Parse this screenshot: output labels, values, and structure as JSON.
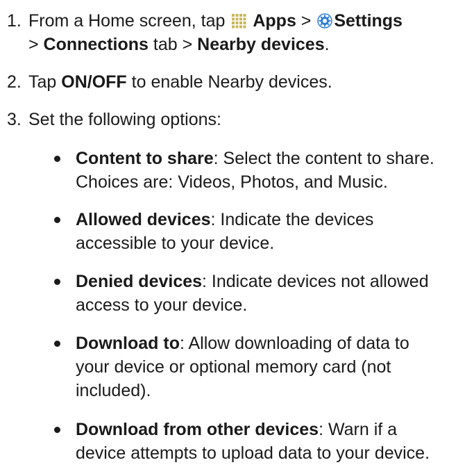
{
  "steps": [
    {
      "number": "1.",
      "line1_pre": "From a Home screen, tap ",
      "apps_icon": "apps-grid-icon",
      "apps": "Apps",
      "sep1": " > ",
      "settings_icon": "settings-gear-icon",
      "settings": "Settings",
      "sep2": "> ",
      "connections": "Connections",
      "tab": " tab > ",
      "nearby": "Nearby devices",
      "period": "."
    },
    {
      "number": "2.",
      "pre": "Tap ",
      "onoff": "ON/OFF",
      "post": " to enable Nearby devices."
    },
    {
      "number": "3.",
      "text": "Set the following options:"
    }
  ],
  "options": [
    {
      "term": "Content to share",
      "line1": ": Select the content to share.",
      "line2": "Choices are: Videos, Photos, and Music."
    },
    {
      "term": "Allowed devices",
      "line1": ": Indicate the devices",
      "line2": "accessible to your device."
    },
    {
      "term": "Denied devices",
      "line1": ": Indicate devices not allowed",
      "line2": "access to your device."
    },
    {
      "term": "Download to",
      "line1": ": Allow downloading of data to",
      "line2": "your device or optional memory card (not",
      "line3": "included)."
    },
    {
      "term": "Download from other devices",
      "line1": ": Warn if a",
      "line2": "device attempts to upload data to your device."
    }
  ],
  "colors": {
    "text": "#1a1a1a",
    "apps_icon": "#c9b85a",
    "settings_icon": "#2f7fd6"
  }
}
